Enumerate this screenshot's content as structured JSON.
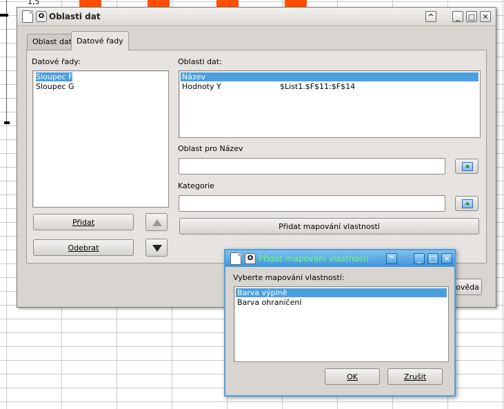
{
  "background": {
    "y_tick_label": "1,5",
    "bar_color": "#ff4e00"
  },
  "main_dialog": {
    "title": "Oblasti dat",
    "menu_icon": "circle-menu-icon",
    "tabs": [
      {
        "label": "Oblast dat",
        "active": false
      },
      {
        "label": "Datové řady",
        "active": true
      }
    ],
    "series_label": "Datové řady:",
    "series": [
      {
        "label": "Sloupec F",
        "selected": true
      },
      {
        "label": "Sloupec G",
        "selected": false
      }
    ],
    "ranges_label": "Oblasti dat:",
    "ranges": [
      {
        "name": "Název",
        "value": "",
        "selected": true
      },
      {
        "name": "Hodnoty Y",
        "value": "$List1.$F$11:$F$14",
        "selected": false
      }
    ],
    "range_for_label": "Oblast pro Název",
    "range_for_value": "",
    "categories_label": "Kategorie",
    "categories_value": "",
    "add_button": "Přidat",
    "remove_button": "Odebrat",
    "add_mapping_button": "Přidat mapování vlastností",
    "help_button_partial": "ověda"
  },
  "mapping_dialog": {
    "title": "Přidat mapování vlastností",
    "prompt": "Vyberte mapování vlastností:",
    "options": [
      {
        "label": "Barva výplně",
        "selected": true
      },
      {
        "label": "Barva ohraničení",
        "selected": false
      }
    ],
    "ok_button": "OK",
    "cancel_button": "Zrušit"
  },
  "colors": {
    "selection": "#4a9fe0",
    "dialog_bg": "#d8d4d0",
    "active_title": "#3d94dc"
  }
}
